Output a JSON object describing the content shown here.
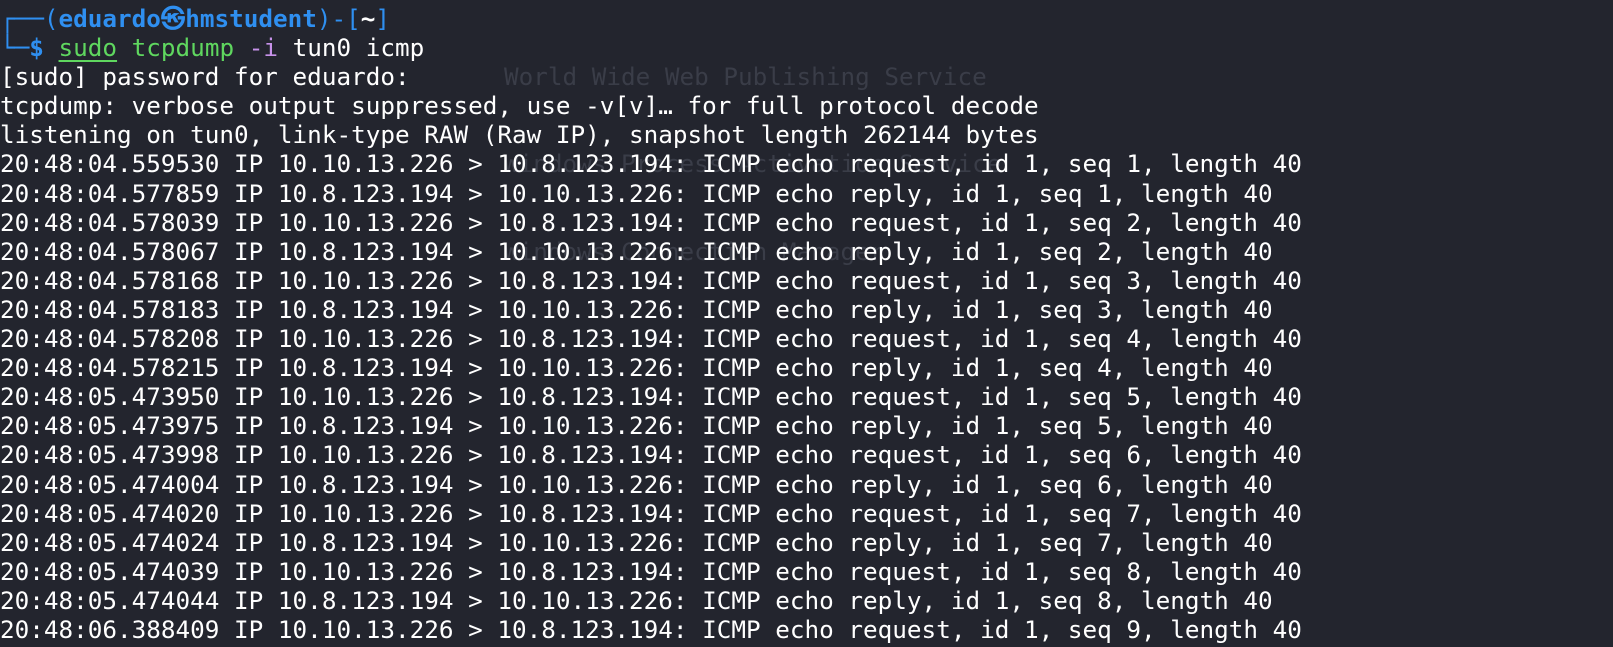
{
  "window": {
    "type": "terminal"
  },
  "prompt": {
    "frame_top": "┌──(",
    "user_host_user": "eduardo",
    "skull": "㉿",
    "host": "hmstudent",
    "frame_mid": ")-[",
    "path": "~",
    "frame_end": "]",
    "frame_bottom": "└─",
    "dollar": "$ ",
    "cmd_sudo": "sudo",
    "cmd_name": " tcpdump",
    "cmd_flag": " -i",
    "cmd_args": " tun0 icmp"
  },
  "output": {
    "sudo_prompt": "[sudo] password for eduardo:",
    "verbose_note": "tcpdump: verbose output suppressed, use -v[v]… for full protocol decode",
    "listening": "listening on tun0, link-type RAW (Raw IP), snapshot length 262144 bytes",
    "packets": [
      "20:48:04.559530 IP 10.10.13.226 > 10.8.123.194: ICMP echo request, id 1, seq 1, length 40",
      "20:48:04.577859 IP 10.8.123.194 > 10.10.13.226: ICMP echo reply, id 1, seq 1, length 40",
      "20:48:04.578039 IP 10.10.13.226 > 10.8.123.194: ICMP echo request, id 1, seq 2, length 40",
      "20:48:04.578067 IP 10.8.123.194 > 10.10.13.226: ICMP echo reply, id 1, seq 2, length 40",
      "20:48:04.578168 IP 10.10.13.226 > 10.8.123.194: ICMP echo request, id 1, seq 3, length 40",
      "20:48:04.578183 IP 10.8.123.194 > 10.10.13.226: ICMP echo reply, id 1, seq 3, length 40",
      "20:48:04.578208 IP 10.10.13.226 > 10.8.123.194: ICMP echo request, id 1, seq 4, length 40",
      "20:48:04.578215 IP 10.8.123.194 > 10.10.13.226: ICMP echo reply, id 1, seq 4, length 40",
      "20:48:05.473950 IP 10.10.13.226 > 10.8.123.194: ICMP echo request, id 1, seq 5, length 40",
      "20:48:05.473975 IP 10.8.123.194 > 10.10.13.226: ICMP echo reply, id 1, seq 5, length 40",
      "20:48:05.473998 IP 10.10.13.226 > 10.8.123.194: ICMP echo request, id 1, seq 6, length 40",
      "20:48:05.474004 IP 10.8.123.194 > 10.10.13.226: ICMP echo reply, id 1, seq 6, length 40",
      "20:48:05.474020 IP 10.10.13.226 > 10.8.123.194: ICMP echo request, id 1, seq 7, length 40",
      "20:48:05.474024 IP 10.8.123.194 > 10.10.13.226: ICMP echo reply, id 1, seq 7, length 40",
      "20:48:05.474039 IP 10.10.13.226 > 10.8.123.194: ICMP echo request, id 1, seq 8, length 40",
      "20:48:05.474044 IP 10.8.123.194 > 10.10.13.226: ICMP echo reply, id 1, seq 8, length 40",
      "20:48:06.388409 IP 10.10.13.226 > 10.8.123.194: ICMP echo request, id 1, seq 9, length 40"
    ]
  },
  "background_ghost": [
    "World Wide Web Publishing Service",
    "Windows Process Activation Service",
    "Windows Connection Manager"
  ],
  "colors": {
    "background": "#23252e",
    "prompt_blue": "#2f8ff0",
    "command_green": "#5fd75f",
    "flag_purple": "#c792ea",
    "text": "#ffffff",
    "ghost_text": "#3a3d48"
  }
}
